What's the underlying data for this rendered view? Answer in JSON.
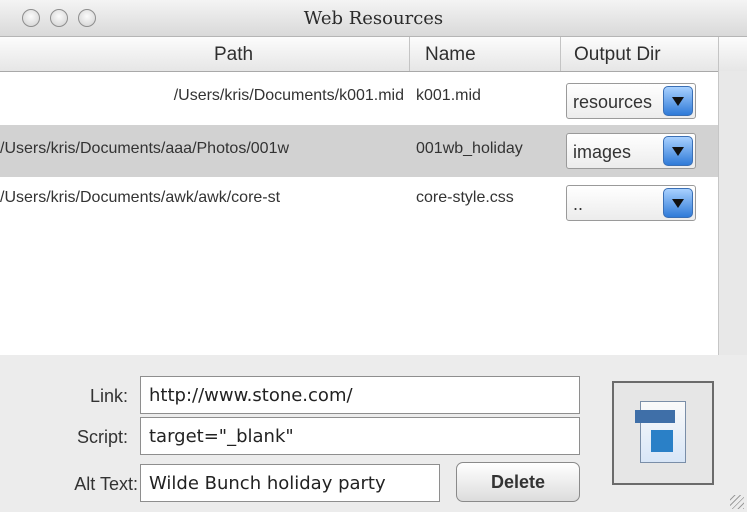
{
  "window": {
    "title": "Web Resources"
  },
  "table": {
    "columns": [
      "Path",
      "Name",
      "Output Dir"
    ],
    "rows": [
      {
        "path": "/Users/kris/Documents/k001.mid",
        "name": "k001.mid",
        "output_dir": "resources",
        "selected": false
      },
      {
        "path": "/Users/kris/Documents/aaa/Photos/001w",
        "name": "001wb_holiday",
        "output_dir": "images",
        "selected": true
      },
      {
        "path": "/Users/kris/Documents/awk/awk/core-st",
        "name": "core-style.css",
        "output_dir": "..",
        "selected": false
      }
    ]
  },
  "form": {
    "link_label": "Link:",
    "link_value": "http://www.stone.com/",
    "script_label": "Script:",
    "script_value": "target=\"_blank\"",
    "alt_label": "Alt Text:",
    "alt_value": "Wilde Bunch holiday  party",
    "delete_label": "Delete"
  },
  "icons": {
    "window_buttons": [
      "close-icon",
      "minimize-icon",
      "zoom-icon"
    ],
    "popup_arrow": "chevron-down-icon",
    "preview": "image-document-icon",
    "resize": "resize-grip-icon"
  },
  "colors": {
    "selection": "#d2d2d2",
    "popup_button": "#2f7ad8"
  }
}
